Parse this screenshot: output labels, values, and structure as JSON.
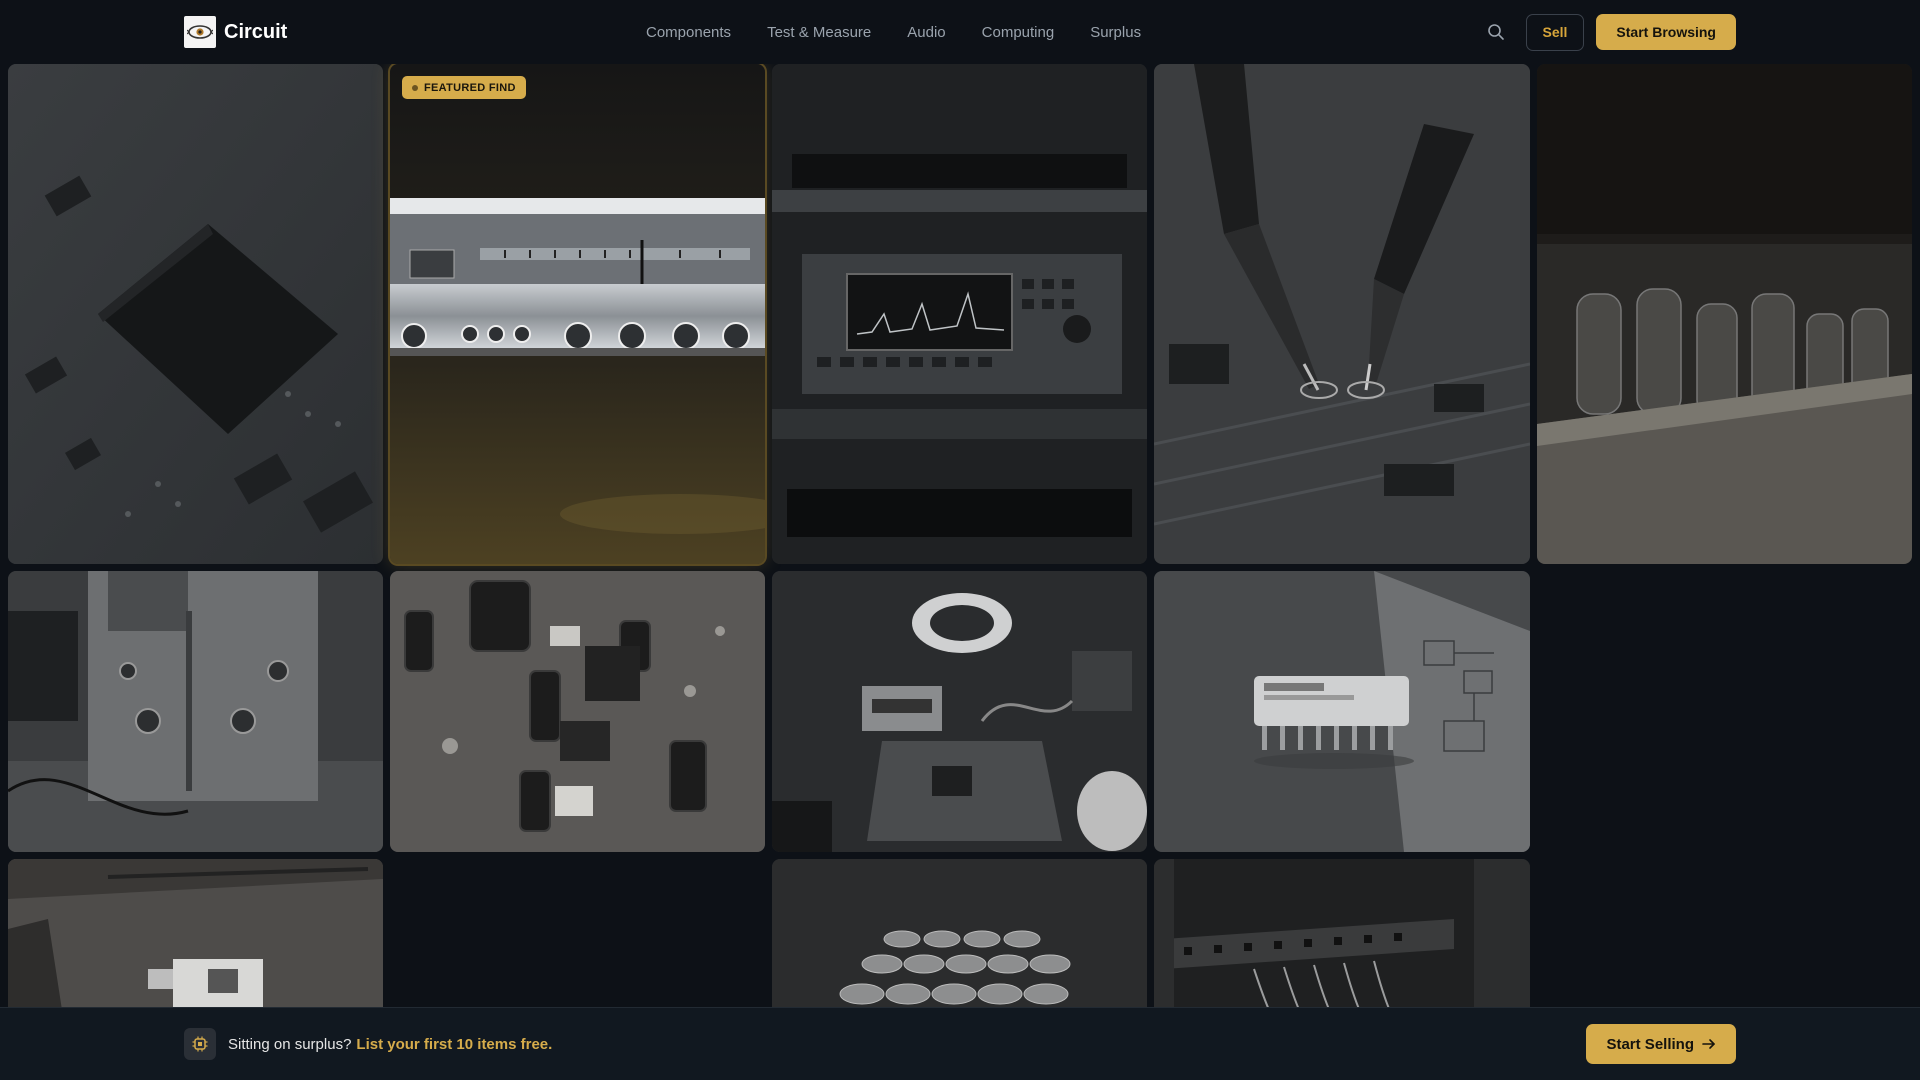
{
  "header": {
    "brand_name": "Circuit",
    "logo_icon": "circuit-eye-logo",
    "nav": [
      "Components",
      "Test & Measure",
      "Audio",
      "Computing",
      "Surplus"
    ],
    "search_icon": "search-icon",
    "sell_label": "Sell",
    "browse_label": "Start Browsing"
  },
  "gallery": {
    "featured_badge": "FEATURED FIND",
    "tiles": [
      "circuit-board-chip",
      "vintage-stereo-receiver",
      "rack-spectrum-analyzer",
      "oscilloscope-probes-on-pcb",
      "vacuum-tube-amplifier",
      "bench-oscilloscope",
      "capacitor-pcb-closeup",
      "soldering-workbench-magnifier",
      "dip-ic-on-schematic",
      "raspberry-pi-board",
      "capacitor-array",
      "network-patch-panel"
    ]
  },
  "footer": {
    "prompt": "Sitting on surplus?",
    "link": "List your first 10 items free.",
    "cta_label": "Start Selling",
    "icon": "chip-icon",
    "arrow_icon": "arrow-right-icon"
  },
  "colors": {
    "background": "#0d1117",
    "accent": "#d6ac4b",
    "footer_bg": "#111820"
  }
}
